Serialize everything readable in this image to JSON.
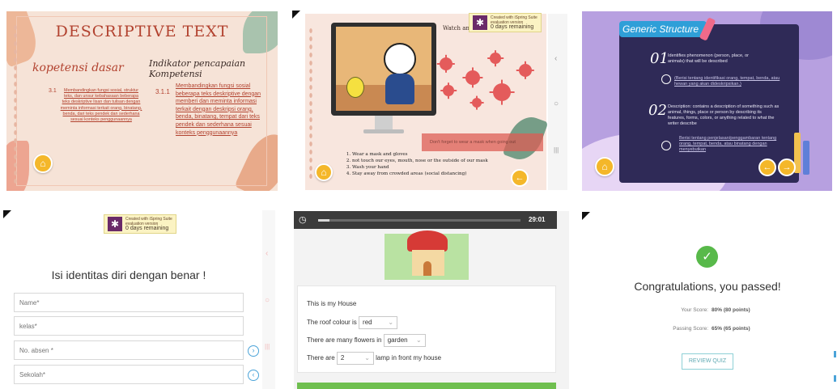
{
  "panel1": {
    "title": "DESCRIPTIVE TEXT",
    "kd_heading": "kopetensi dasar",
    "ipk_heading": "Indikator pencapaian Kompetensi",
    "kd_number": "3.1",
    "kd_text": "Membandingkan fungsi sosial, struktur teks, dan unsur kebahasaan beberapa teks deskriptive lisan dan tulisan dengan meminta informasi terkait orang, binatang, benda, dari teks pendek dan sederhana sesuai konteks penggunaannya",
    "ipk_number": "3.1.1",
    "ipk_text": "Membandingkan fungsi sosial beberapa teks deskriptive dengan memberi dan meminta informasi terkait dengan deskripsi orang, benda, binatang, tempat dari teks pendek dan sederhana sesuai konteks penggunaannya",
    "home_icon": "home-icon"
  },
  "panel2": {
    "badge_line1": "Created with iSpring Suite",
    "badge_line2": "evaluation version",
    "badge_line3": "0 days remaining",
    "watch_label": "Watch and",
    "tooltip": "Don't forget to wear a mask when going out",
    "rules": [
      "Wear a mask and gloves",
      "not touch our eyes, mouth, nose or the outside of our mask",
      "Wash your hand",
      "Stay away from crowded areas (social distancing)"
    ],
    "side_nav": [
      "‹",
      "○",
      "|||"
    ]
  },
  "panel3": {
    "title": "Generic Structure",
    "item1_number": "01",
    "item1_text": "Identifies phenomenon (person, place, or animals) that will be described",
    "item1_note": "(Berisi tentang identifikasi orang, tempat, benda, atau hewan yang akan dideskripsikan.)",
    "item2_number": "02",
    "item2_text": "Description: contains a description of something such as animal, things, place or person by describing its features, forms, colors, or anything related to what the writer describe",
    "item2_note": "Berisi tentang penjelasan/penggambaran tentang orang, tempat, benda, atau binatang dengan menyebutkan"
  },
  "panel4": {
    "badge_line1": "Created with iSpring Suite",
    "badge_line2": "evaluation version",
    "badge_line3": "0 days remaining",
    "heading": "Isi identitas diri dengan benar !",
    "fields": [
      {
        "placeholder": "Name*"
      },
      {
        "placeholder": "kelas*"
      },
      {
        "placeholder": "No. absen *"
      },
      {
        "placeholder": "Sekolah*"
      }
    ],
    "side_nav": [
      "‹",
      "○",
      "|||"
    ]
  },
  "panel5": {
    "timer": "29:01",
    "title": "This is my House",
    "q1_prefix": "The roof colour is",
    "q1_value": "red",
    "q2_prefix": "There are many flowers in",
    "q2_value": "garden",
    "q3_prefix": "There are",
    "q3_value": "2",
    "q3_suffix": "lamp in front my house"
  },
  "panel6": {
    "heading": "Congratulations, you passed!",
    "your_score_label": "Your Score:",
    "your_score_value": "80% (80 points)",
    "passing_score_label": "Passing Score:",
    "passing_score_value": "65% (65 points)",
    "review_button": "REVIEW QUIZ"
  },
  "colors": {
    "peach": "#f6e3d7",
    "kd_heading": "#b2422f",
    "dark_panel": "#2f2a57",
    "purple_bg": "#b7a0e0",
    "green_check": "#58b94a",
    "review_border": "#8ed0d6",
    "quiz_bar": "#3b3b3b"
  }
}
